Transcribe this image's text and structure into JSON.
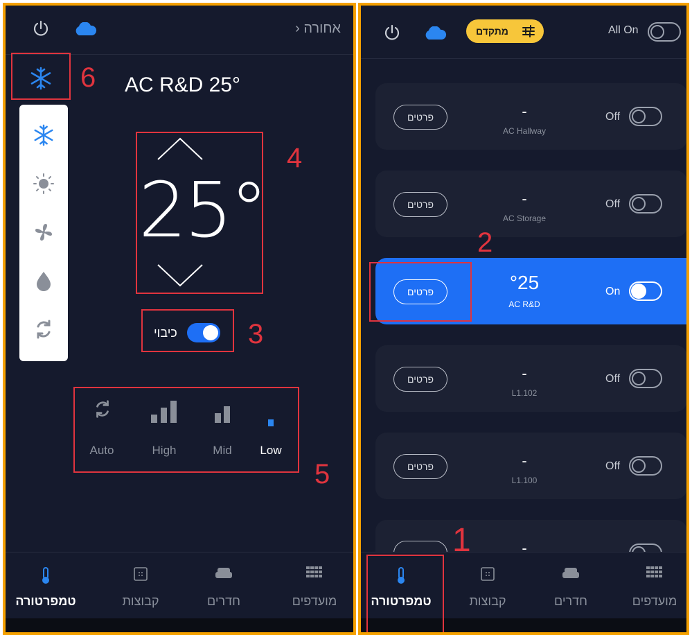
{
  "left": {
    "header": {
      "back_label": "› אחורה"
    },
    "device_title": "AC R&D 25°",
    "temperature": "25°",
    "power_toggle": {
      "label": "כיבוי",
      "on": true
    },
    "mode_options": [
      "snowflake-icon",
      "sun-icon",
      "fan-icon",
      "drop-icon",
      "refresh-icon"
    ],
    "fan_speeds": [
      {
        "label": "Auto",
        "active": false
      },
      {
        "label": "High",
        "active": false
      },
      {
        "label": "Mid",
        "active": false
      },
      {
        "label": "Low",
        "active": true
      }
    ],
    "annotations": [
      "6",
      "4",
      "3",
      "5"
    ]
  },
  "right": {
    "header": {
      "advanced_label": "מתקדם",
      "all_on_label": "All On"
    },
    "devices": [
      {
        "details": "פרטים",
        "value": "-",
        "name": "AC Hallway",
        "state": "Off",
        "active": false
      },
      {
        "details": "פרטים",
        "value": "-",
        "name": "AC Storage",
        "state": "Off",
        "active": false
      },
      {
        "details": "פרטים",
        "value": "°25",
        "name": "AC R&D",
        "state": "On",
        "active": true
      },
      {
        "details": "פרטים",
        "value": "-",
        "name": "L1.102",
        "state": "Off",
        "active": false
      },
      {
        "details": "פרטים",
        "value": "-",
        "name": "L1.100",
        "state": "Off",
        "active": false
      },
      {
        "details": "",
        "value": "-",
        "name": "",
        "state": "",
        "active": false
      }
    ],
    "annotations": [
      "2",
      "1"
    ]
  },
  "bottom_nav": [
    {
      "label": "טמפרטורה",
      "icon": "thermometer-icon",
      "active": true
    },
    {
      "label": "קבוצות",
      "icon": "groups-icon",
      "active": false
    },
    {
      "label": "חדרים",
      "icon": "sofa-icon",
      "active": false
    },
    {
      "label": "מועדפים",
      "icon": "grid-icon",
      "active": false
    }
  ],
  "colors": {
    "background": "#151a2d",
    "accent": "#1e6ff5",
    "highlight": "#f7c63a",
    "annotation": "#e0343e",
    "frame": "#f5a100"
  }
}
